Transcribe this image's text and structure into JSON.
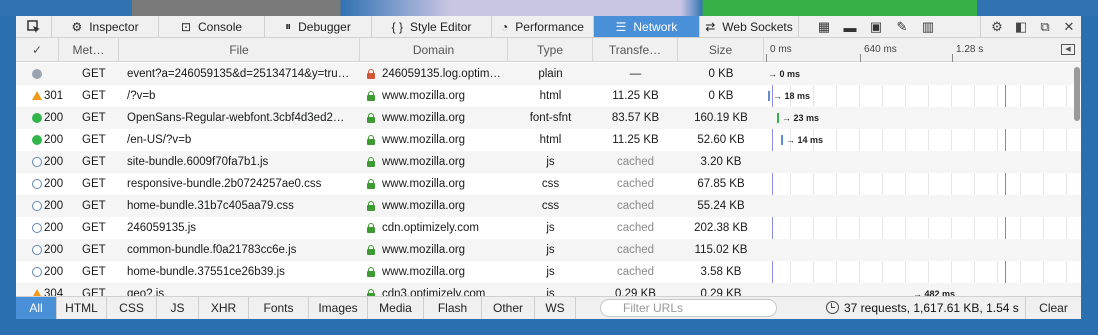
{
  "toolbar": {
    "tabs": [
      {
        "label": "Inspector",
        "icon": "inspector-icon",
        "glyph": "⚙"
      },
      {
        "label": "Console",
        "icon": "console-icon",
        "glyph": "⊡"
      },
      {
        "label": "Debugger",
        "icon": "debugger-icon",
        "glyph": "⏸"
      },
      {
        "label": "Style Editor",
        "icon": "style-editor-icon",
        "glyph": "{ }"
      },
      {
        "label": "Performance",
        "icon": "performance-icon",
        "glyph": "◔"
      },
      {
        "label": "Network",
        "icon": "network-icon",
        "glyph": "☰"
      },
      {
        "label": "Web Sockets",
        "icon": "websockets-icon",
        "glyph": "⇄"
      }
    ],
    "active_tab": "Network"
  },
  "columns": {
    "status": "✓",
    "method": "Met…",
    "file": "File",
    "domain": "Domain",
    "type": "Type",
    "transferred": "Transfe…",
    "size": "Size"
  },
  "timeline_ticks": [
    "0 ms",
    "640 ms",
    "1.28 s"
  ],
  "requests": [
    {
      "status": "",
      "status_icon": "gray",
      "method": "GET",
      "file": "event?a=246059135&d=25134714&y=tru…",
      "secure": "broken",
      "domain": "246059135.log.optim…",
      "type": "plain",
      "transferred": "—",
      "size": "0 KB",
      "timing": "→ 0 ms"
    },
    {
      "status": "301",
      "status_icon": "warning",
      "method": "GET",
      "file": "/?v=b",
      "secure": "yes",
      "domain": "www.mozilla.org",
      "type": "html",
      "transferred": "11.25 KB",
      "size": "0 KB",
      "timing": "→ 18 ms"
    },
    {
      "status": "200",
      "status_icon": "green",
      "method": "GET",
      "file": "OpenSans-Regular-webfont.3cbf4d3ed2…",
      "secure": "yes",
      "domain": "www.mozilla.org",
      "type": "font-sfnt",
      "transferred": "83.57 KB",
      "size": "160.19 KB",
      "timing": "→ 23 ms"
    },
    {
      "status": "200",
      "status_icon": "green",
      "method": "GET",
      "file": "/en-US/?v=b",
      "secure": "yes",
      "domain": "www.mozilla.org",
      "type": "html",
      "transferred": "11.25 KB",
      "size": "52.60 KB",
      "timing": "→ 14 ms"
    },
    {
      "status": "200",
      "status_icon": "hollow",
      "method": "GET",
      "file": "site-bundle.6009f70fa7b1.js",
      "secure": "yes",
      "domain": "www.mozilla.org",
      "type": "js",
      "transferred": "cached",
      "size": "3.20 KB",
      "timing": ""
    },
    {
      "status": "200",
      "status_icon": "hollow",
      "method": "GET",
      "file": "responsive-bundle.2b0724257ae0.css",
      "secure": "yes",
      "domain": "www.mozilla.org",
      "type": "css",
      "transferred": "cached",
      "size": "67.85 KB",
      "timing": ""
    },
    {
      "status": "200",
      "status_icon": "hollow",
      "method": "GET",
      "file": "home-bundle.31b7c405aa79.css",
      "secure": "yes",
      "domain": "www.mozilla.org",
      "type": "css",
      "transferred": "cached",
      "size": "55.24 KB",
      "timing": ""
    },
    {
      "status": "200",
      "status_icon": "hollow",
      "method": "GET",
      "file": "246059135.js",
      "secure": "yes",
      "domain": "cdn.optimizely.com",
      "type": "js",
      "transferred": "cached",
      "size": "202.38 KB",
      "timing": ""
    },
    {
      "status": "200",
      "status_icon": "hollow",
      "method": "GET",
      "file": "common-bundle.f0a21783cc6e.js",
      "secure": "yes",
      "domain": "www.mozilla.org",
      "type": "js",
      "transferred": "cached",
      "size": "115.02 KB",
      "timing": ""
    },
    {
      "status": "200",
      "status_icon": "hollow",
      "method": "GET",
      "file": "home-bundle.37551ce26b39.js",
      "secure": "yes",
      "domain": "www.mozilla.org",
      "type": "js",
      "transferred": "cached",
      "size": "3.58 KB",
      "timing": ""
    },
    {
      "status": "304",
      "status_icon": "warning",
      "method": "GET",
      "file": "geo?.js",
      "secure": "yes",
      "domain": "cdn3.optimizely.com",
      "type": "js",
      "transferred": "0.29 KB",
      "size": "0.29 KB",
      "timing": "→ 482 ms"
    }
  ],
  "filters": [
    "All",
    "HTML",
    "CSS",
    "JS",
    "XHR",
    "Fonts",
    "Images",
    "Media",
    "Flash",
    "Other",
    "WS"
  ],
  "active_filter": "All",
  "search": {
    "placeholder": "Filter URLs",
    "value": ""
  },
  "summary": "37 requests, 1,617.61 KB, 1.54 s",
  "clear_label": "Clear",
  "colors": {
    "accent": "#4a90d9",
    "secure": "#3e9a32",
    "ok": "#31b44b",
    "warning": "#f09a1a"
  }
}
